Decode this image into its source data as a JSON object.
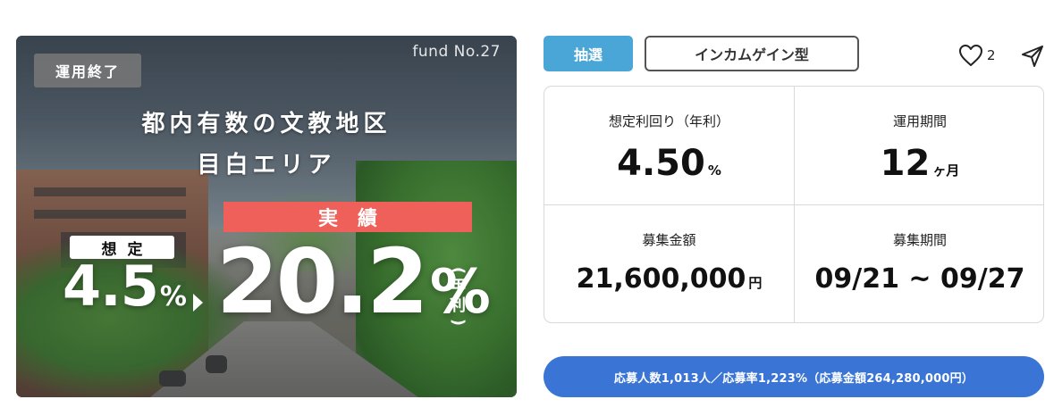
{
  "hero": {
    "status_tag": "運用終了",
    "fund_number": "fund No.27",
    "headline_line1": "都内有数の文教地区",
    "headline_line2": "目白エリア",
    "actual_band": "実績",
    "assumed_label": "想定",
    "assumed_rate": "4.5",
    "assumed_rate_unit": "%",
    "actual_rate": "20.2",
    "actual_rate_unit": "%",
    "annual_label_top": "年",
    "annual_label_bottom": "利"
  },
  "tags": {
    "lottery": "抽選",
    "type": "インカムゲイン型"
  },
  "actions": {
    "like_count": "2"
  },
  "info": {
    "yield_label": "想定利回り（年利）",
    "yield_value": "4.50",
    "yield_unit": "%",
    "period_label": "運用期間",
    "period_value": "12",
    "period_unit": "ヶ月",
    "amount_label": "募集金額",
    "amount_value": "21,600,000",
    "amount_unit": "円",
    "recruit_label": "募集期間",
    "recruit_value": "09/21 ~ 09/27"
  },
  "apply_summary": "応募人数1,013人／応募率1,223%（応募金額264,280,000円）",
  "colors": {
    "lottery": "#4aa6d6",
    "actual_band": "#f0605a",
    "apply_bar": "#3a75d6"
  }
}
